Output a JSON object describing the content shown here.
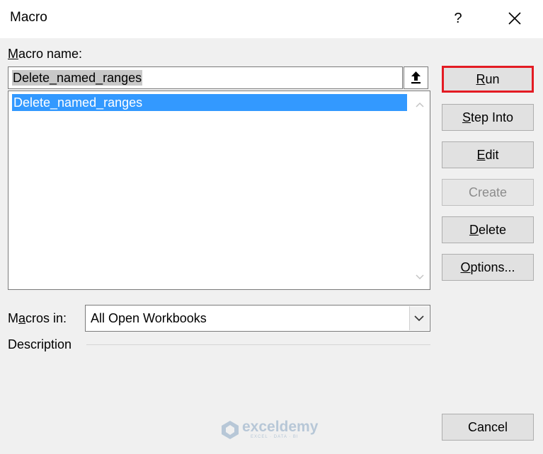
{
  "window": {
    "title": "Macro",
    "help_label": "?",
    "close_label": "✕"
  },
  "macro_name": {
    "label": "Macro name:",
    "value": "Delete_named_ranges"
  },
  "macro_list": {
    "items": [
      "Delete_named_ranges"
    ],
    "selected_index": 0
  },
  "buttons": {
    "run": "Run",
    "step_into": "Step Into",
    "edit": "Edit",
    "create": "Create",
    "delete": "Delete",
    "options": "Options...",
    "cancel": "Cancel"
  },
  "macros_in": {
    "label": "Macros in:",
    "selected": "All Open Workbooks"
  },
  "description": {
    "label": "Description"
  },
  "watermark": {
    "name": "exceldemy",
    "tagline": "EXCEL · DATA · BI"
  },
  "colors": {
    "selection": "#3399ff",
    "highlight_border": "#e31b23"
  },
  "icons": {
    "upload": "upload-arrow-icon",
    "scroll_up": "chevron-up-icon",
    "scroll_down": "chevron-down-icon",
    "dropdown": "chevron-down-icon"
  }
}
